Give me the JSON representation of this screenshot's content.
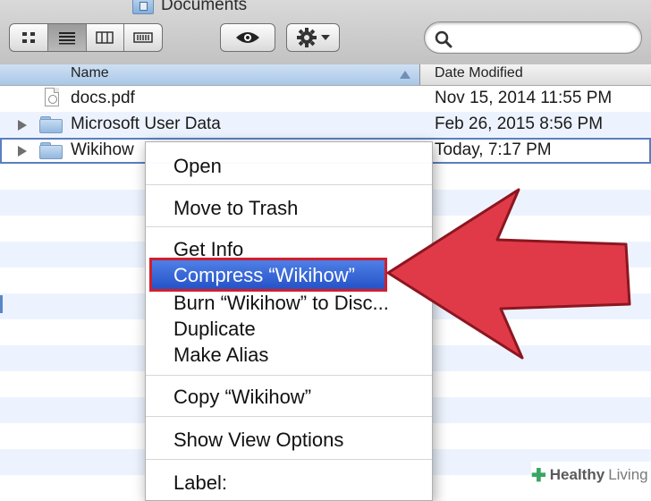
{
  "window": {
    "title": "Documents"
  },
  "toolbar": {
    "view_buttons": [
      "icon-view-icon",
      "list-view-icon",
      "column-view-icon",
      "coverflow-view-icon"
    ],
    "quicklook_icon": "eye-icon",
    "action_icon": "gear-icon",
    "search_placeholder": ""
  },
  "columns": {
    "name": "Name",
    "date_modified": "Date Modified"
  },
  "files": [
    {
      "name": "docs.pdf",
      "date": "Nov 15, 2014 11:55 PM",
      "kind": "document"
    },
    {
      "name": "Microsoft User Data",
      "date": "Feb 26, 2015 8:56 PM",
      "kind": "folder"
    },
    {
      "name": "Wikihow",
      "date": "Today, 7:17 PM",
      "kind": "folder"
    }
  ],
  "context_menu": {
    "open": "Open",
    "move_to_trash": "Move to Trash",
    "get_info": "Get Info",
    "compress": "Compress “Wikihow”",
    "burn": "Burn “Wikihow” to Disc...",
    "duplicate": "Duplicate",
    "make_alias": "Make Alias",
    "copy": "Copy “Wikihow”",
    "show_view_options": "Show View Options",
    "label": "Label:"
  },
  "colors": {
    "highlight": "#2f5fd6",
    "annotation_arrow": "#e03a48",
    "selection_outline": "#5b7fbf"
  },
  "watermark": {
    "brand": "Healthy",
    "brand2": "Living"
  }
}
